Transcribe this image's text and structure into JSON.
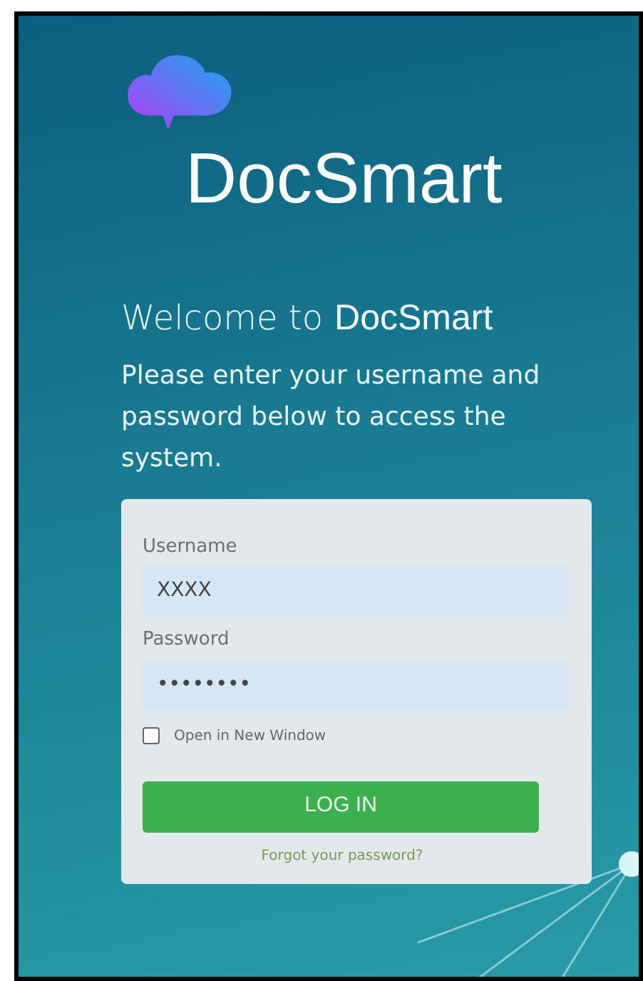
{
  "brand": {
    "name": "DocSmart"
  },
  "welcome": {
    "lead": "Welcome to",
    "brand": "DocSmart",
    "text": "Please enter your username and password below to access the system."
  },
  "form": {
    "fields": [
      {
        "label": "Username",
        "value": "XXXX"
      },
      {
        "label": "Password",
        "value": "••••••••"
      }
    ],
    "open_new_window": {
      "label": "Open in New Window",
      "checked": false
    },
    "submit": "LOG IN",
    "forgot": "Forgot your password?"
  }
}
